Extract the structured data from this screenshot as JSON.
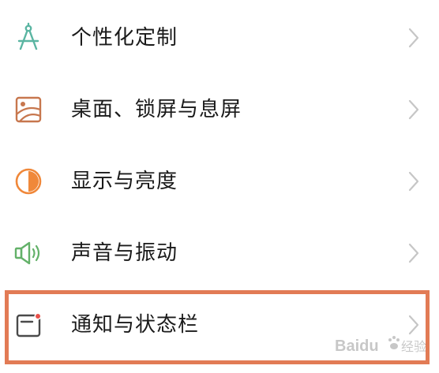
{
  "settings": {
    "items": [
      {
        "label": "个性化定制",
        "icon": "compass-icon",
        "color": "#5ab5a2"
      },
      {
        "label": "桌面、锁屏与息屏",
        "icon": "wallpaper-icon",
        "color": "#c7774e"
      },
      {
        "label": "显示与亮度",
        "icon": "brightness-icon",
        "color": "#f0883a"
      },
      {
        "label": "声音与振动",
        "icon": "speaker-icon",
        "color": "#63b169"
      },
      {
        "label": "通知与状态栏",
        "icon": "notification-icon",
        "color": "#4a4a4a"
      }
    ],
    "chevron_color": "#c6c6c6"
  },
  "highlight": {
    "color": "#e27b55",
    "target": "通知与状态栏"
  },
  "watermark": {
    "brand": "Baidu",
    "brand_cn": "经验",
    "logo": "baidu-paw-icon"
  }
}
